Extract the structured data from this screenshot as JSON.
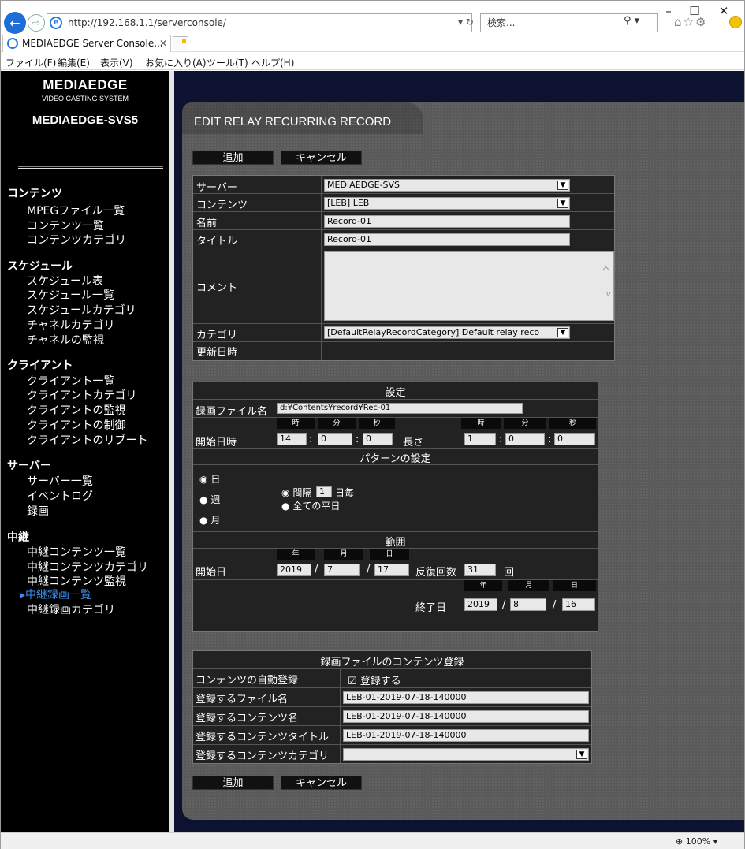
{
  "browser": {
    "address": "http://192.168.1.1/serverconsole/",
    "search_placeholder": "検索...",
    "tab_title": "MEDIAEDGE Server Console...",
    "menu": [
      "ファイル(F)",
      "編集(E)",
      "表示(V)",
      "お気に入り(A)",
      "ツール(T)",
      "ヘルプ(H)"
    ],
    "zoom": "100%"
  },
  "sidebar": {
    "logo_main": "MEDIAEDGE",
    "logo_sub": "VIDEO CASTING SYSTEM",
    "server_name": "MEDIAEDGE-SVS5",
    "sections": [
      {
        "title": "コンテンツ",
        "items": [
          "MPEGファイル一覧",
          "コンテンツ一覧",
          "コンテンツカテゴリ"
        ]
      },
      {
        "title": "スケジュール",
        "items": [
          "スケジュール表",
          "スケジュール一覧",
          "スケジュールカテゴリ",
          "チャネルカテゴリ",
          "チャネルの監視"
        ]
      },
      {
        "title": "クライアント",
        "items": [
          "クライアント一覧",
          "クライアントカテゴリ",
          "クライアントの監視",
          "クライアントの制御",
          "クライアントのリブート"
        ]
      },
      {
        "title": "サーバー",
        "items": [
          "サーバー一覧",
          "イベントログ",
          "録画"
        ]
      },
      {
        "title": "中継",
        "items": [
          "中継コンテンツ一覧",
          "中継コンテンツカテゴリ",
          "中継コンテンツ監視",
          "▸中継録画一覧",
          "中継録画カテゴリ"
        ]
      }
    ]
  },
  "main": {
    "title": "EDIT RELAY RECURRING RECORD",
    "add_label": "追加",
    "cancel_label": "キャンセル",
    "basic": {
      "server_label": "サーバー",
      "server_value": "MEDIAEDGE-SVS",
      "content_label": "コンテンツ",
      "content_value": "[LEB] LEB",
      "name_label": "名前",
      "name_value": "Record-01",
      "title_label": "タイトル",
      "title_value": "Record-01",
      "comment_label": "コメント",
      "comment_value": "",
      "category_label": "カテゴリ",
      "category_value": "[DefaultRelayRecordCategory] Default relay reco",
      "updated_label": "更新日時",
      "updated_value": ""
    },
    "settings": {
      "header": "設定",
      "file_label": "録画ファイル名",
      "file_value": "d:¥Contents¥record¥Rec-01",
      "hour_hdr": "時",
      "min_hdr": "分",
      "sec_hdr": "秒",
      "start_label": "開始日時",
      "start_h": "14",
      "start_m": "0",
      "start_s": "0",
      "length_label": "長さ",
      "len_h": "1",
      "len_m": "0",
      "len_s": "0",
      "pattern_header": "パターンの設定",
      "day": "日",
      "week": "週",
      "month": "月",
      "interval_pre": "間隔",
      "interval_value": "1",
      "interval_post": "日毎",
      "weekdays": "全ての平日",
      "range_header": "範囲",
      "year_hdr": "年",
      "month_hdr": "月",
      "day_hdr": "日",
      "start_date_label": "開始日",
      "start_y": "2019",
      "start_mo": "7",
      "start_d": "17",
      "repeat_label": "反復回数",
      "repeat_value": "31",
      "repeat_unit": "回",
      "end_date_label": "終了日",
      "end_y": "2019",
      "end_mo": "8",
      "end_d": "16",
      "sep_colon": ":",
      "sep_slash": "/"
    },
    "registration": {
      "header": "録画ファイルのコンテンツ登録",
      "auto_label": "コンテンツの自動登録",
      "auto_value": "登録する",
      "file_label": "登録するファイル名",
      "file_value": "LEB-01-2019-07-18-140000",
      "content_label": "登録するコンテンツ名",
      "content_value": "LEB-01-2019-07-18-140000",
      "ctitle_label": "登録するコンテンツタイトル",
      "ctitle_value": "LEB-01-2019-07-18-140000",
      "category_label": "登録するコンテンツカテゴリ",
      "category_value": ""
    }
  }
}
